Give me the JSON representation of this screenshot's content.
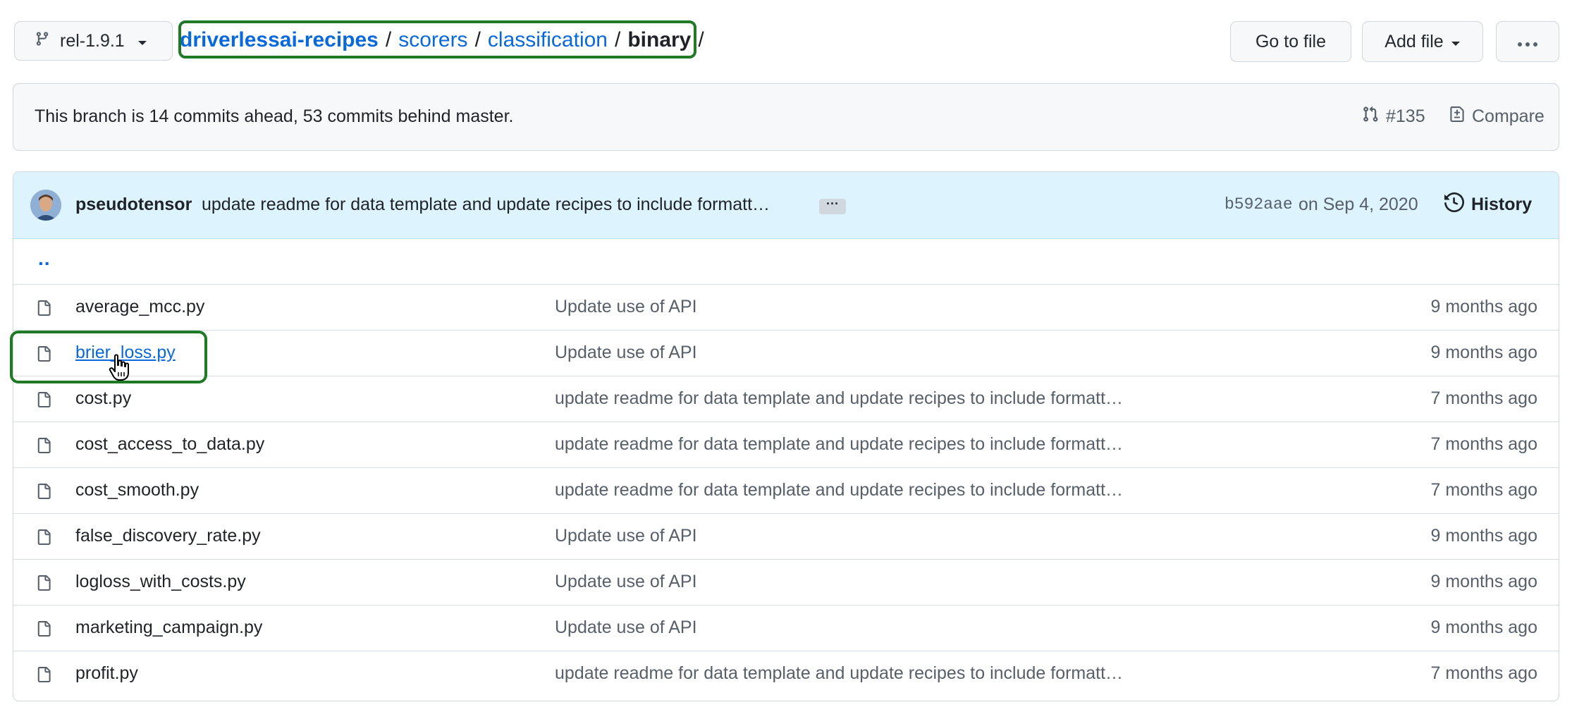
{
  "branch": {
    "name": "rel-1.9.1"
  },
  "breadcrumb": {
    "repo": "driverlessai-recipes",
    "parts": [
      "scorers",
      "classification"
    ],
    "current": "binary",
    "separator": "/"
  },
  "actions": {
    "go_to_file": "Go to file",
    "add_file": "Add file",
    "more": "···"
  },
  "branch_info": {
    "message": "This branch is 14 commits ahead, 53 commits behind master.",
    "pr": "#135",
    "compare": "Compare"
  },
  "commit": {
    "author": "pseudotensor",
    "message": "update readme for data template and update recipes to include formatt…",
    "ellipsis": "···",
    "sha": "b592aae",
    "date": "on Sep 4, 2020",
    "history": "History"
  },
  "parent_dir": "..",
  "files": [
    {
      "name": "average_mcc.py",
      "message": "Update use of API",
      "age": "9 months ago"
    },
    {
      "name": "brier_loss.py",
      "message": "Update use of API",
      "age": "9 months ago"
    },
    {
      "name": "cost.py",
      "message": "update readme for data template and update recipes to include formatt…",
      "age": "7 months ago"
    },
    {
      "name": "cost_access_to_data.py",
      "message": "update readme for data template and update recipes to include formatt…",
      "age": "7 months ago"
    },
    {
      "name": "cost_smooth.py",
      "message": "update readme for data template and update recipes to include formatt…",
      "age": "7 months ago"
    },
    {
      "name": "false_discovery_rate.py",
      "message": "Update use of API",
      "age": "9 months ago"
    },
    {
      "name": "logloss_with_costs.py",
      "message": "Update use of API",
      "age": "9 months ago"
    },
    {
      "name": "marketing_campaign.py",
      "message": "Update use of API",
      "age": "9 months ago"
    },
    {
      "name": "profit.py",
      "message": "update readme for data template and update recipes to include formatt…",
      "age": "7 months ago"
    }
  ],
  "icons": {
    "branch": "git-branch-icon",
    "caret": "triangle-down-icon",
    "pr": "pull-request-icon",
    "compare": "file-diff-icon",
    "history": "history-clock-icon",
    "file": "file-icon",
    "cursor": "hand-pointer-cursor"
  },
  "colors": {
    "link": "#0969da",
    "highlight": "#1e7a24",
    "commit_bar": "#ddf4ff",
    "muted": "#57606a"
  }
}
